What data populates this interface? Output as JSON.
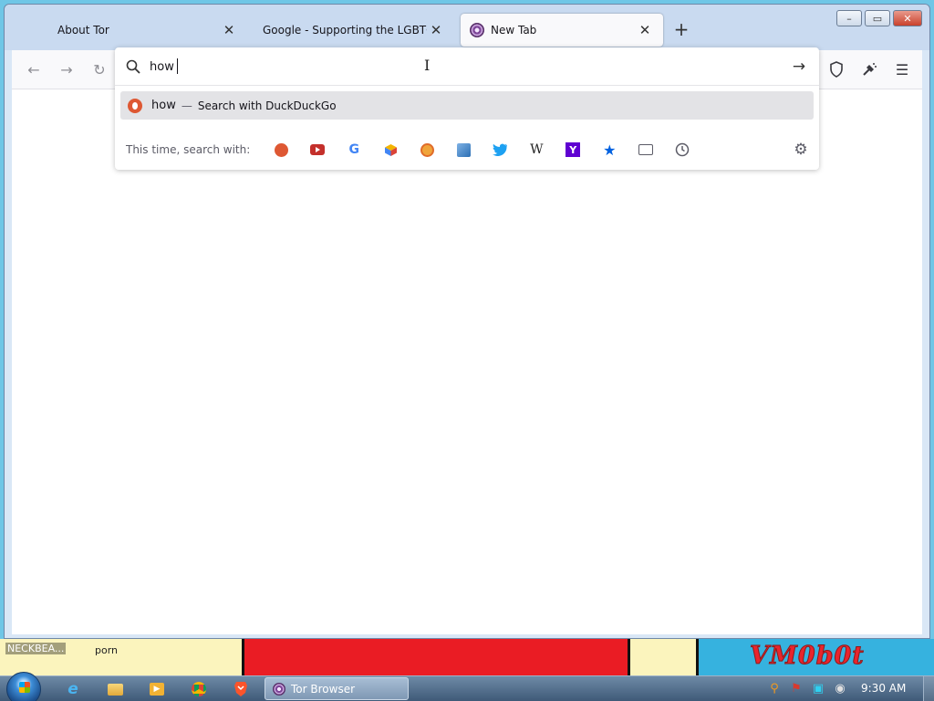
{
  "window": {
    "tabs": [
      {
        "title": "About Tor",
        "close": "✕",
        "active": false
      },
      {
        "title": "Google - Supporting the LGBTQ+ C",
        "close": "✕",
        "active": false
      },
      {
        "title": "New Tab",
        "close": "✕",
        "active": true
      }
    ],
    "new_tab": "+",
    "controls": {
      "minimize": "–",
      "maximize": "▭",
      "close": "✕"
    }
  },
  "toolbar": {
    "back": "←",
    "forward": "→",
    "reload": "↻",
    "shield": "shield-icon",
    "broom": "new-identity-icon",
    "menu": "☰"
  },
  "urlbar": {
    "value": "how",
    "go": "→",
    "suggestion": {
      "term": "how",
      "dash": "—",
      "action": "Search with DuckDuckGo"
    },
    "one_offs": {
      "label": "This time, search with:",
      "engines": [
        "duckduckgo",
        "youtube",
        "google",
        "blockchair",
        "startpage",
        "wikimedia",
        "twitter",
        "wikipedia",
        "yahoo",
        "bookmarks",
        "tabs",
        "history"
      ],
      "settings": "⚙"
    }
  },
  "desktop": {
    "label": "NECKBEA...",
    "wallpaper_text": "porn",
    "logo": "VM0b0t"
  },
  "taskbar": {
    "task_label": "Tor Browser",
    "clock": "9:30 AM"
  },
  "colors": {
    "accent": "#0061e0",
    "tor_purple": "#7d4698",
    "ddg_orange": "#de5833",
    "wallpaper_red": "#ea1c24",
    "wallpaper_blue": "#36b2df"
  }
}
